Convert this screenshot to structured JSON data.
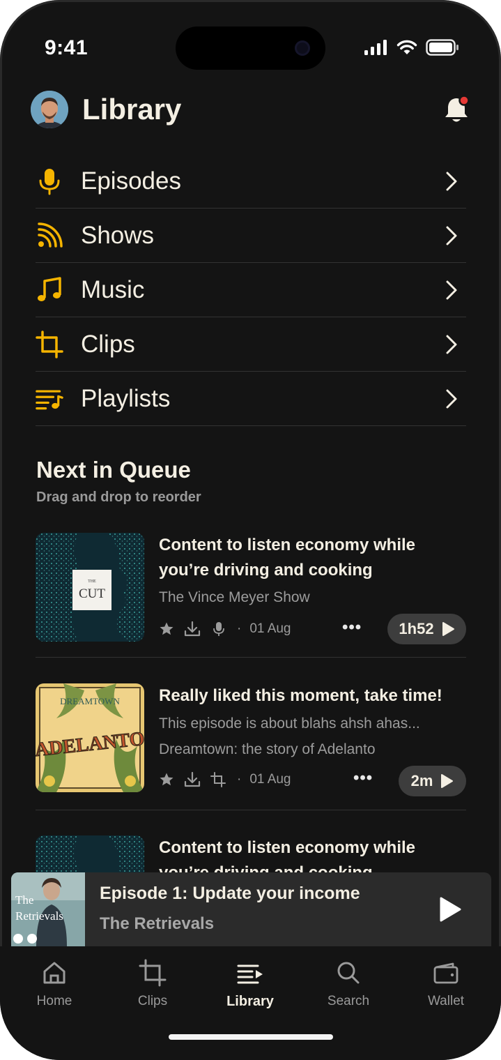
{
  "status": {
    "time": "9:41"
  },
  "header": {
    "title": "Library"
  },
  "menu": {
    "items": [
      {
        "label": "Episodes",
        "icon": "microphone-icon"
      },
      {
        "label": "Shows",
        "icon": "rss-icon"
      },
      {
        "label": "Music",
        "icon": "music-note-icon"
      },
      {
        "label": "Clips",
        "icon": "crop-icon"
      },
      {
        "label": "Playlists",
        "icon": "playlist-icon"
      }
    ]
  },
  "queue": {
    "title": "Next in Queue",
    "subtitle": "Drag and drop to reorder",
    "items": [
      {
        "title": "Content to listen economy while you’re driving and cooking",
        "show": "The Vince Meyer Show",
        "date": "01 Aug",
        "duration": "1h52",
        "art_label": "CUT",
        "art_label_small": "THE"
      },
      {
        "title": "Really liked this moment, take time!",
        "description": "This episode is about blahs ahsh ahas...",
        "show": "Dreamtown: the story of Adelanto",
        "date": "01 Aug",
        "duration": "2m",
        "art_label": "ADELANTO",
        "art_label_small": "DREAMTOWN"
      },
      {
        "title": "Content to listen economy while you’re driving and cooking"
      }
    ]
  },
  "player": {
    "title": "Episode 1: Update your income",
    "show": "The Retrievals",
    "art_text": "The Retrievals"
  },
  "tabs": [
    {
      "label": "Home",
      "icon": "home-icon"
    },
    {
      "label": "Clips",
      "icon": "crop-icon"
    },
    {
      "label": "Library",
      "icon": "library-icon",
      "active": true
    },
    {
      "label": "Search",
      "icon": "search-icon"
    },
    {
      "label": "Wallet",
      "icon": "wallet-icon"
    }
  ],
  "colors": {
    "accent": "#F5B400",
    "background": "#141414",
    "text": "#F4EFE3",
    "notification": "#E53935"
  }
}
